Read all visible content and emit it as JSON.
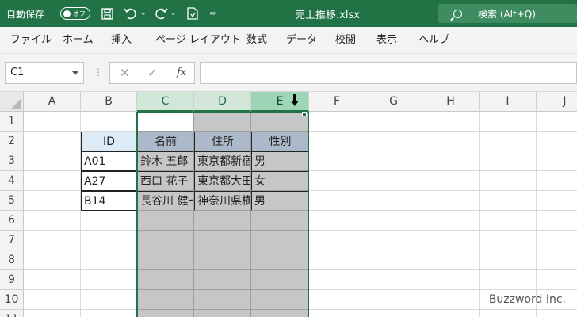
{
  "titlebar": {
    "autosave_label": "自動保存",
    "autosave_state": "オフ",
    "document_title": "売上推移.xlsx",
    "search_label": "検索 (Alt+Q)",
    "quick_access_icons": [
      "save-icon",
      "undo-icon",
      "redo-icon",
      "touch-mode-icon",
      "customize-icon"
    ]
  },
  "ribbon": {
    "tabs": [
      "ファイル",
      "ホーム",
      "挿入",
      "ページ レイアウト",
      "数式",
      "データ",
      "校閲",
      "表示",
      "ヘルプ"
    ]
  },
  "formula_bar": {
    "name_box": "C1",
    "fx_label": "fx",
    "formula": ""
  },
  "sheet": {
    "columns": [
      "A",
      "B",
      "C",
      "D",
      "E",
      "F",
      "G",
      "H",
      "I",
      "J"
    ],
    "rows": [
      "1",
      "2",
      "3",
      "4",
      "5",
      "6",
      "7",
      "8",
      "9",
      "10",
      "11"
    ],
    "header_row": {
      "B": "ID",
      "C": "名前",
      "D": "住所",
      "E": "性別"
    },
    "data_rows": [
      {
        "B": "A01",
        "C": "鈴木 五郎",
        "D": "東京都新宿",
        "E": "男"
      },
      {
        "B": "A27",
        "C": "西口 花子",
        "D": "東京都大田",
        "E": "女"
      },
      {
        "B": "B14",
        "C": "長谷川 健一",
        "D": "神奈川県横",
        "E": "男"
      }
    ],
    "selection": "C:E"
  },
  "watermark": "Buzzword Inc."
}
